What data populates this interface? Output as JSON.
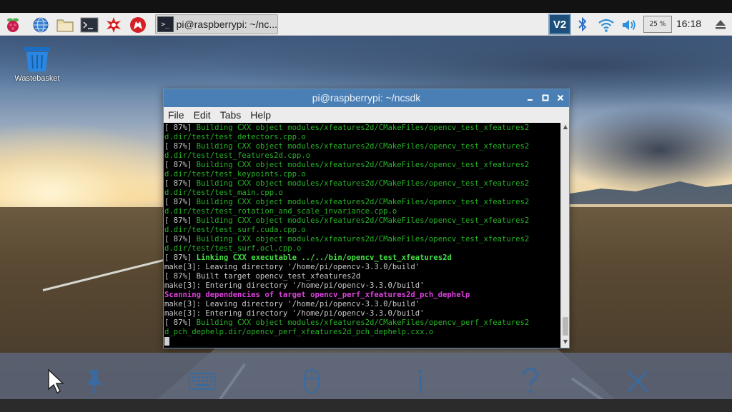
{
  "taskbar": {
    "task_button_label": "pi@raspberrypi: ~/nc...",
    "vnc_label": "V2",
    "cpu_usage": "25 %",
    "clock": "16:18"
  },
  "desktop": {
    "trash_label": "Wastebasket"
  },
  "terminal": {
    "title": "pi@raspberrypi: ~/ncsdk",
    "menu": [
      "File",
      "Edit",
      "Tabs",
      "Help"
    ],
    "lines": [
      {
        "prefix": "[ 87%] ",
        "text": "Building CXX object modules/xfeatures2d/CMakeFiles/opencv_test_xfeatures2",
        "style": "green"
      },
      {
        "prefix": "",
        "text": "d.dir/test/test_detectors.cpp.o",
        "style": "green"
      },
      {
        "prefix": "[ 87%] ",
        "text": "Building CXX object modules/xfeatures2d/CMakeFiles/opencv_test_xfeatures2",
        "style": "green"
      },
      {
        "prefix": "",
        "text": "d.dir/test/test_features2d.cpp.o",
        "style": "green"
      },
      {
        "prefix": "[ 87%] ",
        "text": "Building CXX object modules/xfeatures2d/CMakeFiles/opencv_test_xfeatures2",
        "style": "green"
      },
      {
        "prefix": "",
        "text": "d.dir/test/test_keypoints.cpp.o",
        "style": "green"
      },
      {
        "prefix": "[ 87%] ",
        "text": "Building CXX object modules/xfeatures2d/CMakeFiles/opencv_test_xfeatures2",
        "style": "green"
      },
      {
        "prefix": "",
        "text": "d.dir/test/test_main.cpp.o",
        "style": "green"
      },
      {
        "prefix": "[ 87%] ",
        "text": "Building CXX object modules/xfeatures2d/CMakeFiles/opencv_test_xfeatures2",
        "style": "green"
      },
      {
        "prefix": "",
        "text": "d.dir/test/test_rotation_and_scale_invariance.cpp.o",
        "style": "green"
      },
      {
        "prefix": "[ 87%] ",
        "text": "Building CXX object modules/xfeatures2d/CMakeFiles/opencv_test_xfeatures2",
        "style": "green"
      },
      {
        "prefix": "",
        "text": "d.dir/test/test_surf.cuda.cpp.o",
        "style": "green"
      },
      {
        "prefix": "[ 87%] ",
        "text": "Building CXX object modules/xfeatures2d/CMakeFiles/opencv_test_xfeatures2",
        "style": "green"
      },
      {
        "prefix": "",
        "text": "d.dir/test/test_surf.ocl.cpp.o",
        "style": "green"
      },
      {
        "prefix": "[ 87%] ",
        "text": "Linking CXX executable ../../bin/opencv_test_xfeatures2d",
        "style": "bgreen"
      },
      {
        "prefix": "",
        "text": "make[3]: Leaving directory '/home/pi/opencv-3.3.0/build'",
        "style": "plain"
      },
      {
        "prefix": "",
        "text": "[ 87%] Built target opencv_test_xfeatures2d",
        "style": "plain"
      },
      {
        "prefix": "",
        "text": "make[3]: Entering directory '/home/pi/opencv-3.3.0/build'",
        "style": "plain"
      },
      {
        "prefix": "",
        "text": "Scanning dependencies of target opencv_perf_xfeatures2d_pch_dephelp",
        "style": "magenta"
      },
      {
        "prefix": "",
        "text": "make[3]: Leaving directory '/home/pi/opencv-3.3.0/build'",
        "style": "plain"
      },
      {
        "prefix": "",
        "text": "make[3]: Entering directory '/home/pi/opencv-3.3.0/build'",
        "style": "plain"
      },
      {
        "prefix": "[ 87%] ",
        "text": "Building CXX object modules/xfeatures2d/CMakeFiles/opencv_perf_xfeatures2",
        "style": "green"
      },
      {
        "prefix": "",
        "text": "d_pch_dephelp.dir/opencv_perf_xfeatures2d_pch_dephelp.cxx.o",
        "style": "green"
      }
    ]
  },
  "vnc_toolbar": {
    "items": [
      "pointer-icon",
      "pin-icon",
      "keyboard-icon",
      "mouse-icon",
      "info-icon",
      "help-icon",
      "close-icon"
    ]
  },
  "colors": {
    "titlebar": "#4a7fb5",
    "term_green": "#27b327",
    "term_bright_green": "#46e046",
    "term_magenta": "#e040e0",
    "vnc_toolbar": "#5c687e"
  }
}
